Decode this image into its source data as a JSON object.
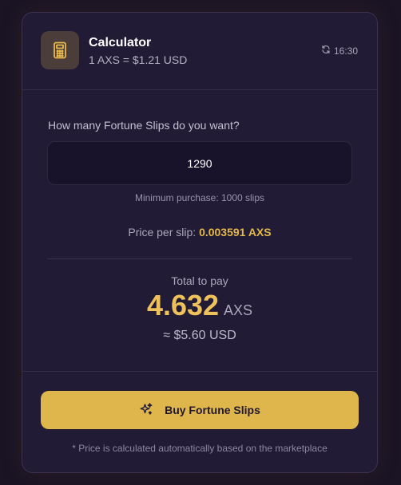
{
  "header": {
    "title": "Calculator",
    "rate": "1 AXS = $1.21 USD",
    "time": "16:30",
    "icon": "calculator-icon",
    "refresh_icon": "refresh-icon"
  },
  "form": {
    "question": "How many Fortune Slips do you want?",
    "quantity_value": "1290",
    "min_note": "Minimum purchase: 1000 slips",
    "price_label": "Price per slip: ",
    "price_value": "0.003591 AXS"
  },
  "total": {
    "label": "Total to pay",
    "amount": "4.632",
    "unit": "AXS",
    "usd": "≈ $5.60 USD"
  },
  "action": {
    "buy_label": "Buy Fortune Slips",
    "buy_icon": "sparkles-icon"
  },
  "footnote": "* Price is calculated automatically based on the marketplace",
  "colors": {
    "accent": "#e2b84a",
    "button": "#deb64b",
    "card": "#211b35",
    "background": "#1a1425"
  }
}
